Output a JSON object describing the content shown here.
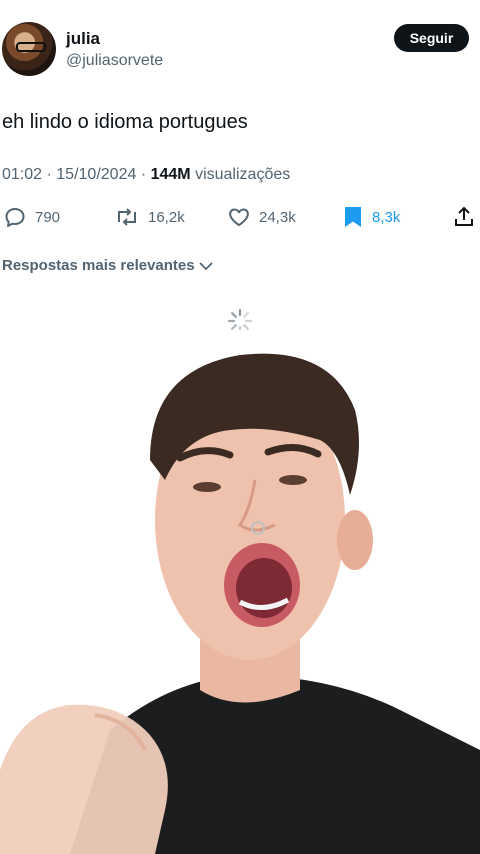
{
  "author": {
    "name": "julia",
    "handle": "@juliasorvete",
    "follow_label": "Seguir"
  },
  "tweet": {
    "text": "eh lindo o idioma portugues"
  },
  "meta": {
    "time": "01:02",
    "date": "15/10/2024",
    "views": "144M",
    "views_label": "visualizações"
  },
  "actions": {
    "replies": "790",
    "retweets": "16,2k",
    "likes": "24,3k",
    "bookmarks": "8,3k"
  },
  "replies_sort": {
    "label": "Respostas mais relevantes"
  },
  "colors": {
    "accent": "#1d9bf0",
    "text": "#0f1419",
    "muted": "#536471"
  }
}
